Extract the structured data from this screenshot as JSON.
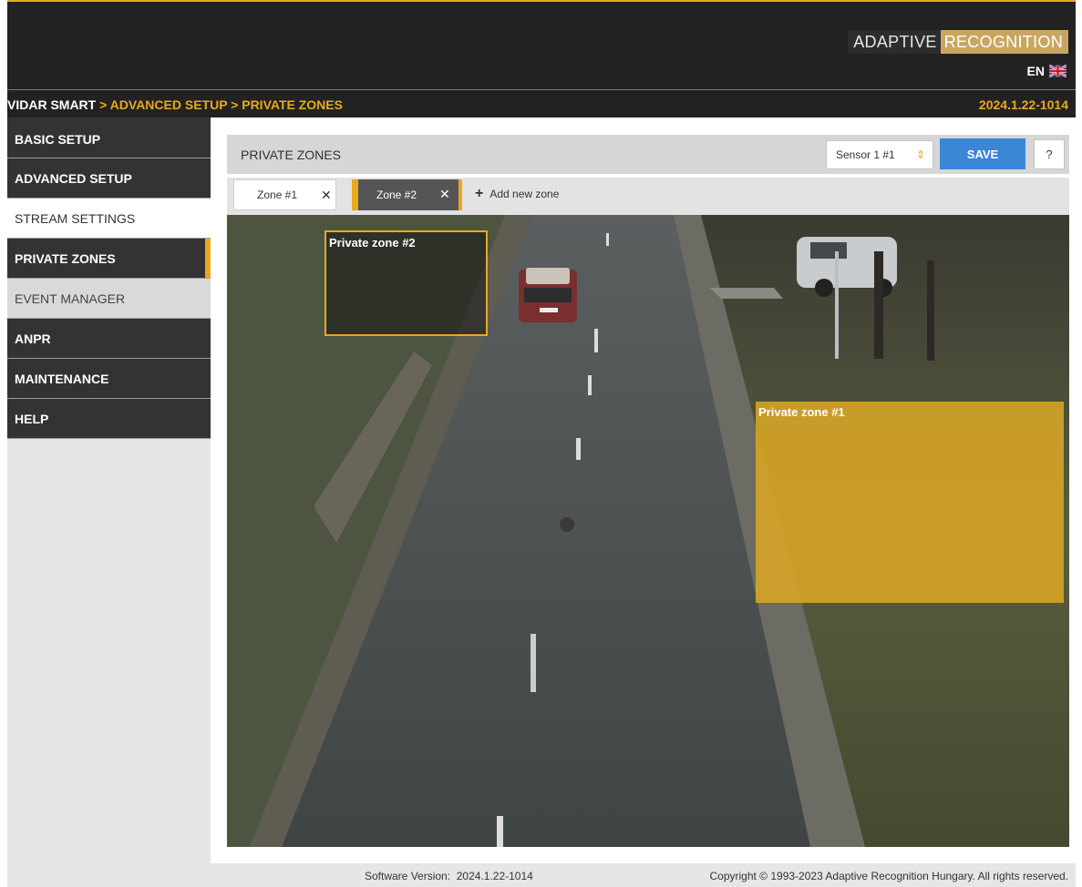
{
  "header": {
    "brand_part1": "ADAPTIVE",
    "brand_part2": "RECOGNITION",
    "language": "EN",
    "breadcrumb_root": "VIDAR SMART",
    "breadcrumb_rest": " > ADVANCED SETUP > PRIVATE ZONES",
    "version": "2024.1.22-1014"
  },
  "sidebar": {
    "items": [
      {
        "label": "BASIC SETUP"
      },
      {
        "label": "ADVANCED SETUP"
      },
      {
        "label": "STREAM SETTINGS"
      },
      {
        "label": "PRIVATE ZONES"
      },
      {
        "label": "EVENT MANAGER"
      },
      {
        "label": "ANPR"
      },
      {
        "label": "MAINTENANCE"
      },
      {
        "label": "HELP"
      }
    ]
  },
  "panel": {
    "title": "PRIVATE ZONES",
    "sensor_value": "Sensor 1 #1",
    "save_label": "SAVE",
    "help_label": "?"
  },
  "tabs": [
    {
      "label": "Zone #1",
      "active": false
    },
    {
      "label": "Zone #2",
      "active": true
    }
  ],
  "add_zone_label": "Add new zone",
  "zones": {
    "zone1_label": "Private zone #1",
    "zone2_label": "Private zone #2"
  },
  "footer": {
    "version_label": "Software Version:",
    "version_value": "2024.1.22-1014",
    "copyright": "Copyright © 1993-2023 Adaptive Recognition Hungary. All rights reserved."
  },
  "colors": {
    "accent": "#e8a91f",
    "header_bg": "#222222",
    "save_button": "#3b86d7",
    "zone_fill": "#d9a626"
  }
}
